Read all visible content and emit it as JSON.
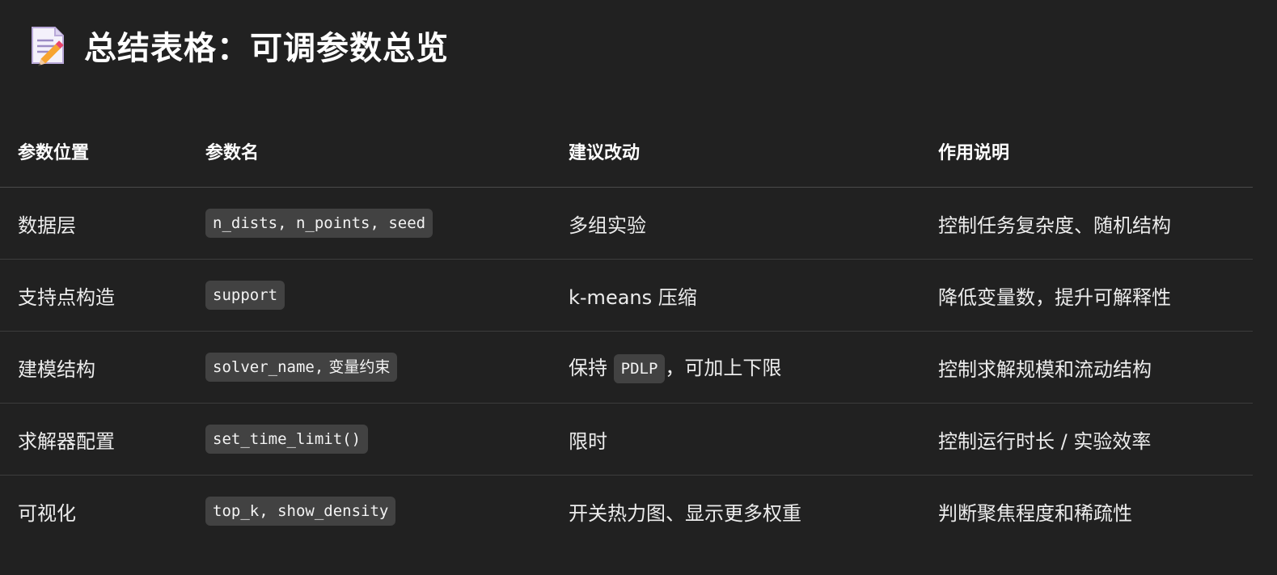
{
  "page": {
    "title": "总结表格：可调参数总览",
    "title_icon": "memo-icon"
  },
  "table": {
    "headers": [
      "参数位置",
      "参数名",
      "建议改动",
      "作用说明"
    ],
    "rows": [
      {
        "location": "数据层",
        "param_code": "n_dists, n_points, seed",
        "param_extra": "",
        "change_before": "多组实验",
        "change_code": "",
        "change_after": "",
        "purpose": "控制任务复杂度、随机结构"
      },
      {
        "location": "支持点构造",
        "param_code": "support",
        "param_extra": "",
        "change_before": "k-means 压缩",
        "change_code": "",
        "change_after": "",
        "purpose": "降低变量数，提升可解释性"
      },
      {
        "location": "建模结构",
        "param_code": "solver_name,",
        "param_extra": " 变量约束",
        "change_before": "保持 ",
        "change_code": "PDLP",
        "change_after": "，可加上下限",
        "purpose": "控制求解规模和流动结构"
      },
      {
        "location": "求解器配置",
        "param_code": "set_time_limit()",
        "param_extra": "",
        "change_before": "限时",
        "change_code": "",
        "change_after": "",
        "purpose": "控制运行时长 / 实验效率"
      },
      {
        "location": "可视化",
        "param_code": "top_k, show_density",
        "param_extra": "",
        "change_before": "开关热力图、显示更多权重",
        "change_code": "",
        "change_after": "",
        "purpose": "判断聚焦程度和稀疏性"
      }
    ]
  }
}
